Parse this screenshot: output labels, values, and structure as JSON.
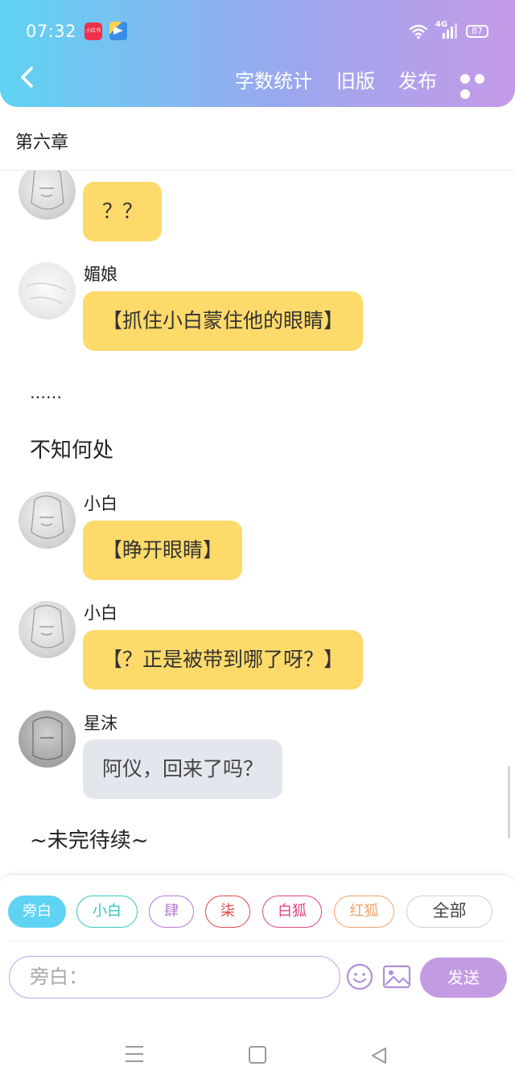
{
  "status_bar": {
    "time": "07:32",
    "app_icon_left": "小红书",
    "network": "4G",
    "battery": "87"
  },
  "header": {
    "back_icon": "chevron-left-icon",
    "word_count": "字数统计",
    "old_version": "旧版",
    "publish": "发布",
    "more_icon": "more-dots-icon"
  },
  "chapter": {
    "title": "第六章"
  },
  "messages": [
    {
      "type": "dialogue",
      "speaker": "",
      "text": "？？",
      "bubble_color": "#fdda6a"
    },
    {
      "type": "dialogue",
      "speaker": "媚娘",
      "text": "【抓住小白蒙住他的眼睛】",
      "bubble_color": "#fdda6a"
    },
    {
      "type": "narration",
      "text": "……"
    },
    {
      "type": "narration",
      "text": "不知何处"
    },
    {
      "type": "dialogue",
      "speaker": "小白",
      "text": "【睁开眼睛】",
      "bubble_color": "#fdda6a"
    },
    {
      "type": "dialogue",
      "speaker": "小白",
      "text": "【？正是被带到哪了呀？】",
      "bubble_color": "#fdda6a"
    },
    {
      "type": "dialogue",
      "speaker": "星沫",
      "text": "阿仪，回来了吗？",
      "bubble_color": "#e3e6ed"
    },
    {
      "type": "narration",
      "text": "~未完待续~"
    }
  ],
  "roles": {
    "narrator": "旁白",
    "xiaobai": "小白",
    "si": "肆",
    "qi": "柒",
    "baihu": "白狐",
    "honghu": "红狐",
    "all": "全部"
  },
  "input": {
    "placeholder": "旁白：",
    "emoji_icon": "smiley-icon",
    "image_icon": "image-icon",
    "send": "发送"
  },
  "colors": {
    "header_gradient_start": "#5fd3f3",
    "header_gradient_end": "#c59ae8",
    "dialogue_bubble": "#fdda6a",
    "reply_bubble": "#e3e6ed",
    "send_button": "#c39be3"
  }
}
